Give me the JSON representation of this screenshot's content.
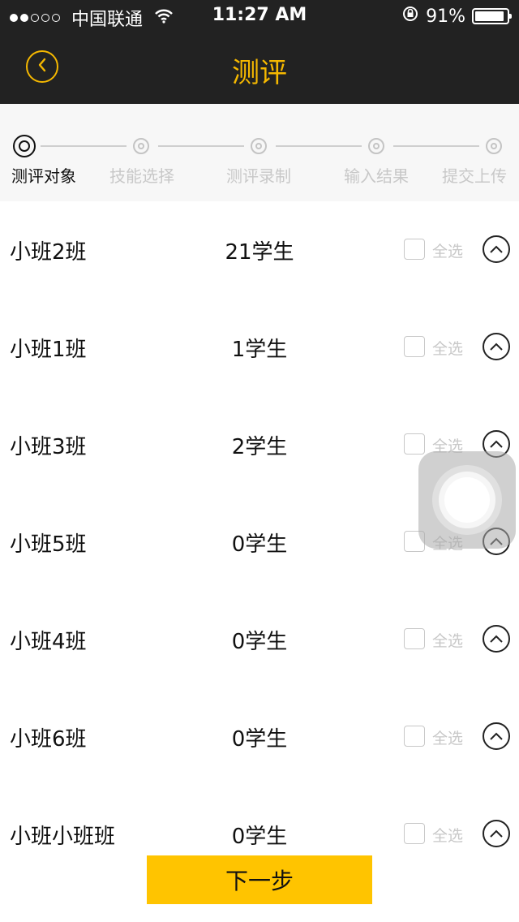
{
  "status_bar": {
    "carrier": "中国联通",
    "time": "11:27 AM",
    "battery": "91%",
    "battery_level": 0.91
  },
  "nav": {
    "title": "测评"
  },
  "steps": [
    {
      "label": "测评对象",
      "active": true
    },
    {
      "label": "技能选择",
      "active": false
    },
    {
      "label": "测评录制",
      "active": false
    },
    {
      "label": "输入结果",
      "active": false
    },
    {
      "label": "提交上传",
      "active": false
    }
  ],
  "classes": [
    {
      "name": "小班2班",
      "count": "21学生",
      "select_label": "全选"
    },
    {
      "name": "小班1班",
      "count": "1学生",
      "select_label": "全选"
    },
    {
      "name": "小班3班",
      "count": "2学生",
      "select_label": "全选"
    },
    {
      "name": "小班5班",
      "count": "0学生",
      "select_label": "全选"
    },
    {
      "name": "小班4班",
      "count": "0学生",
      "select_label": "全选"
    },
    {
      "name": "小班6班",
      "count": "0学生",
      "select_label": "全选"
    },
    {
      "name": "小班小班班",
      "count": "0学生",
      "select_label": "全选"
    }
  ],
  "next_button": "下一步",
  "colors": {
    "accent": "#f5b800",
    "button": "#ffc400",
    "topbar": "#222222"
  }
}
